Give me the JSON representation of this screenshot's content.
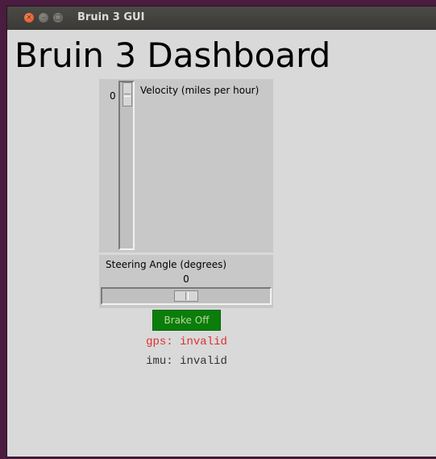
{
  "window": {
    "title": "Bruin 3 GUI",
    "buttons": {
      "close": "×",
      "minimize": "–",
      "maximize": "□"
    }
  },
  "dashboard": {
    "title": "Bruin 3 Dashboard"
  },
  "velocity": {
    "label": "Velocity (miles per hour)",
    "value": "0",
    "slider_fraction": 0
  },
  "steering": {
    "label": "Steering Angle (degrees)",
    "value": "0",
    "slider_fraction": 0.5
  },
  "brake": {
    "label": "Brake Off",
    "color": "#0a7d0a",
    "text_color": "#b9d9a0"
  },
  "status": {
    "gps": {
      "text": "gps: invalid",
      "color": "#e03030"
    },
    "imu": {
      "text": "imu: invalid",
      "color": "#333333"
    }
  }
}
